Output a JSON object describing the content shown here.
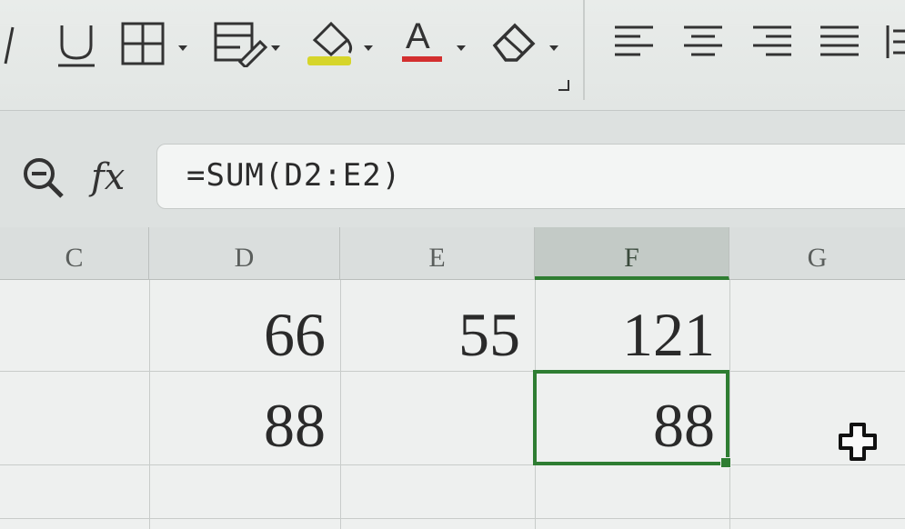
{
  "toolbar": {
    "buttons": [
      {
        "name": "italic-button",
        "icon": "italic-icon"
      },
      {
        "name": "underline-button",
        "icon": "underline-icon"
      },
      {
        "name": "borders-button",
        "icon": "borders-icon"
      },
      {
        "name": "cell-style-button",
        "icon": "cell-style-icon"
      },
      {
        "name": "fill-color-button",
        "icon": "fill-color-icon",
        "color": "#d6d52a"
      },
      {
        "name": "font-color-button",
        "icon": "font-color-icon",
        "color": "#d32f2f"
      },
      {
        "name": "clear-format-button",
        "icon": "eraser-icon"
      },
      {
        "name": "align-left-button",
        "icon": "align-left-icon"
      },
      {
        "name": "align-center-button",
        "icon": "align-center-icon"
      },
      {
        "name": "align-right-button",
        "icon": "align-right-icon"
      },
      {
        "name": "justify-button",
        "icon": "justify-icon"
      }
    ],
    "font_color_glyph": "A"
  },
  "formula_bar": {
    "fx_label": "fx",
    "formula": "=SUM(D2:E2)"
  },
  "grid": {
    "columns": [
      "C",
      "D",
      "E",
      "F",
      "G"
    ],
    "active_column": "F",
    "rows": [
      {
        "D": "66",
        "E": "55",
        "F": "121"
      },
      {
        "D": "88",
        "E": "",
        "F": "88"
      }
    ],
    "selected_cell_value": "88"
  },
  "colors": {
    "selection": "#2e7d32",
    "font_color_bar": "#d32f2f",
    "fill_color_bar": "#d6d52a"
  }
}
